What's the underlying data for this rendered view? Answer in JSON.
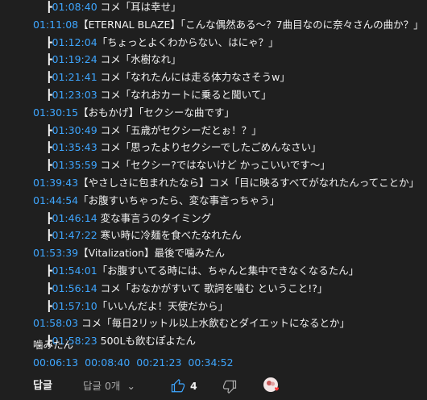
{
  "lines": [
    {
      "branch": "┣",
      "ts": "01:08:40",
      "text": " コメ「耳は幸せ」",
      "indent": 1
    },
    {
      "branch": "",
      "ts": "01:11:08",
      "text": "【ETERNAL BLAZE】「こんな偶然ある～？7曲目なのに奈々さんの曲か？」",
      "indent": 0
    },
    {
      "branch": "┣",
      "ts": "01:12:04",
      "text": "「ちょっとよくわからない、はにゃ？」",
      "indent": 1
    },
    {
      "branch": "┣",
      "ts": "01:19:24",
      "text": " コメ「水樹なれ」",
      "indent": 1
    },
    {
      "branch": "┣",
      "ts": "01:21:41",
      "text": " コメ「なれたんには走る体力なさそうw」",
      "indent": 1
    },
    {
      "branch": "┣",
      "ts": "01:23:03",
      "text": " コメ「なれおカートに乗ると聞いて」",
      "indent": 1
    },
    {
      "branch": "",
      "ts": "01:30:15",
      "text": "【おもかげ】「セクシーな曲です」",
      "indent": 0
    },
    {
      "branch": "┣",
      "ts": "01:30:49",
      "text": " コメ「五歳がセクシーだとぉ！？」",
      "indent": 1
    },
    {
      "branch": "┣",
      "ts": "01:35:43",
      "text": " コメ「思ったよりセクシーでしたごめんなさい」",
      "indent": 1
    },
    {
      "branch": "┣",
      "ts": "01:35:59",
      "text": " コメ「セクシー?ではないけど かっこいいです～」",
      "indent": 1
    },
    {
      "branch": "",
      "ts": "01:39:43",
      "text": "【やさしさに包まれたなら】コメ「目に映るすべてがなれたんってことか」",
      "indent": 0
    },
    {
      "branch": "",
      "ts": "01:44:54",
      "text": "「お腹すいちゃったら、変な事言っちゃう」",
      "indent": 0
    },
    {
      "branch": "┣",
      "ts": "01:46:14",
      "text": " 変な事言うのタイミング",
      "indent": 1
    },
    {
      "branch": "┣",
      "ts": "01:47:22",
      "text": " 寒い時に冷麺を食べたなれたん",
      "indent": 1
    },
    {
      "branch": "",
      "ts": "01:53:39",
      "text": "【Vitalization】最後で噛みたん",
      "indent": 0
    },
    {
      "branch": "┣",
      "ts": "01:54:01",
      "text": "「お腹すいてる時には、ちゃんと集中できなくなるたん」",
      "indent": 1
    },
    {
      "branch": "┣",
      "ts": "01:56:14",
      "text": " コメ「おなかがすいて 歌詞を噛む ということ!?」",
      "indent": 1
    },
    {
      "branch": "┣",
      "ts": "01:57:10",
      "text": "「いいんだよ！天使だから」",
      "indent": 1
    },
    {
      "branch": "",
      "ts": "01:58:03",
      "text": " コメ「毎日2リットル以上水飲むとダイエットになるとか」",
      "indent": 0
    },
    {
      "branch": "┣",
      "ts": "01:58:23",
      "text": " 500Lも飲むぽよたん",
      "indent": 1
    }
  ],
  "closing_text": "噛みたん",
  "closing_timestamps": [
    "00:06:13",
    "00:08:40",
    "00:21:23",
    "00:34:52"
  ],
  "actions": {
    "reply_label": "답글",
    "replies_label": "답글 0개",
    "like_count": "4"
  },
  "colors": {
    "background": "#1f1f1f",
    "text": "#f1f1f1",
    "timestamp": "#3ea6ff",
    "muted": "#aaaaaa"
  }
}
